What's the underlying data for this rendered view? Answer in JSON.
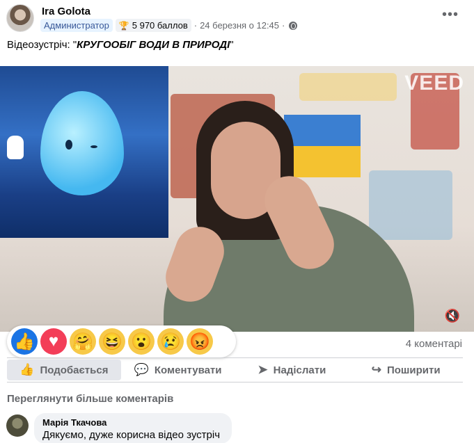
{
  "post": {
    "author": "Ira Golota",
    "role_badge": "Администратор",
    "points": "5 970 баллов",
    "date": "24 березня о 12:45",
    "separator": "·",
    "more_icon": "•••",
    "text_prefix": "Відеозустріч: ",
    "text_quote_open": "\"",
    "text_emphasis": "КРУГООБІГ ВОДИ В ПРИРОДІ",
    "text_quote_close": "\""
  },
  "video": {
    "watermark": "VEED",
    "mute_icon": "🔇"
  },
  "reactions": [
    {
      "name": "like",
      "glyph": "👍"
    },
    {
      "name": "love",
      "glyph": "♥"
    },
    {
      "name": "care",
      "glyph": "🤗"
    },
    {
      "name": "haha",
      "glyph": "😆"
    },
    {
      "name": "wow",
      "glyph": "😮"
    },
    {
      "name": "sad",
      "glyph": "😢"
    },
    {
      "name": "angry",
      "glyph": "😡"
    }
  ],
  "comments_count": "4 коментарі",
  "actions": {
    "like": "Подобається",
    "comment": "Коментувати",
    "send": "Надіслати",
    "share": "Поширити"
  },
  "view_more_comments": "Переглянути більше коментарів",
  "comment": {
    "author": "Марія Ткачова",
    "text": "Дякуємо, дуже корисна відео зустріч !"
  },
  "colors": {
    "accent": "#1b74e4",
    "secondary_text": "#65676b",
    "bubble_bg": "#f0f2f5"
  }
}
